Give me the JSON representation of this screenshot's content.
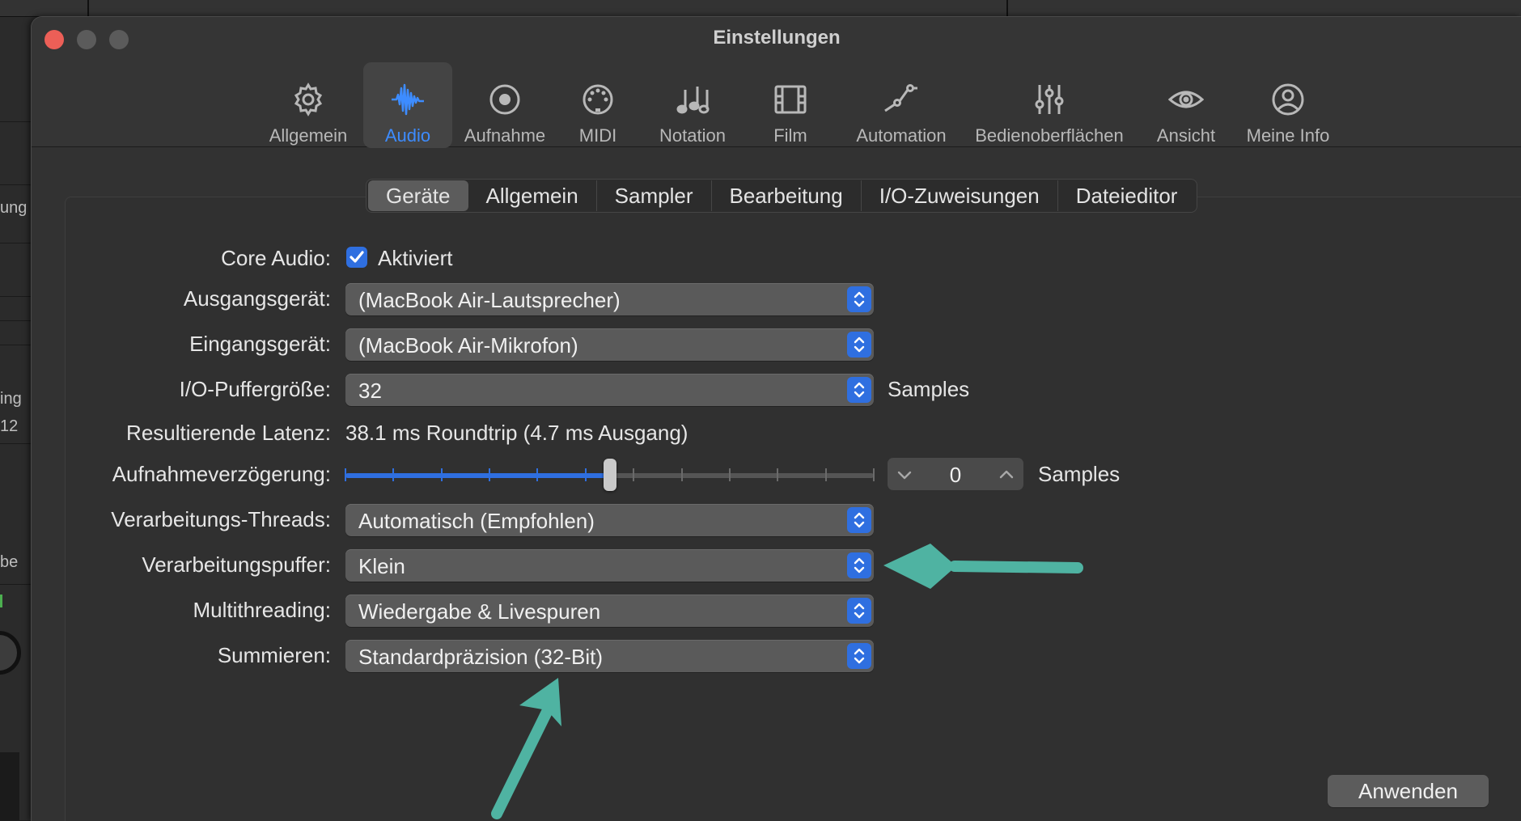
{
  "background": {
    "left_labels": [
      "ung",
      "ing",
      "12",
      "be"
    ]
  },
  "window": {
    "title": "Einstellungen"
  },
  "toolbar": {
    "items": [
      {
        "label": "Allgemein",
        "icon": "gear-icon"
      },
      {
        "label": "Audio",
        "icon": "waveform-icon",
        "active": true
      },
      {
        "label": "Aufnahme",
        "icon": "record-icon"
      },
      {
        "label": "MIDI",
        "icon": "midi-connector-icon"
      },
      {
        "label": "Notation",
        "icon": "music-notes-icon"
      },
      {
        "label": "Film",
        "icon": "film-icon"
      },
      {
        "label": "Automation",
        "icon": "automation-curve-icon"
      },
      {
        "label": "Bedienoberflächen",
        "icon": "sliders-icon"
      },
      {
        "label": "Ansicht",
        "icon": "eye-icon"
      },
      {
        "label": "Meine Info",
        "icon": "person-circle-icon"
      }
    ]
  },
  "subtabs": [
    "Geräte",
    "Allgemein",
    "Sampler",
    "Bearbeitung",
    "I/O-Zuweisungen",
    "Dateieditor"
  ],
  "form": {
    "core_audio": {
      "label": "Core Audio:",
      "checkbox_label": "Aktiviert",
      "checked": true
    },
    "output_device": {
      "label": "Ausgangsgerät:",
      "value": "(MacBook Air-Lautsprecher)"
    },
    "input_device": {
      "label": "Eingangsgerät:",
      "value": "(MacBook Air-Mikrofon)"
    },
    "buffer_size": {
      "label": "I/O-Puffergröße:",
      "value": "32",
      "unit": "Samples"
    },
    "latency": {
      "label": "Resultierende Latenz:",
      "value": "38.1 ms Roundtrip (4.7 ms Ausgang)"
    },
    "record_delay": {
      "label": "Aufnahmeverzögerung:",
      "value": "0",
      "unit": "Samples",
      "slider_fraction": 0.5
    },
    "threads": {
      "label": "Verarbeitungs-Threads:",
      "value": "Automatisch (Empfohlen)"
    },
    "process_buffer": {
      "label": "Verarbeitungspuffer:",
      "value": "Klein"
    },
    "multithreading": {
      "label": "Multithreading:",
      "value": "Wiedergabe & Livespuren"
    },
    "summing": {
      "label": "Summieren:",
      "value": "Standardpräzision (32-Bit)"
    }
  },
  "apply_label": "Anwenden",
  "colors": {
    "accent": "#2f6fe0",
    "annotation_arrow": "#4fb3a2",
    "close": "#ec5f57"
  }
}
